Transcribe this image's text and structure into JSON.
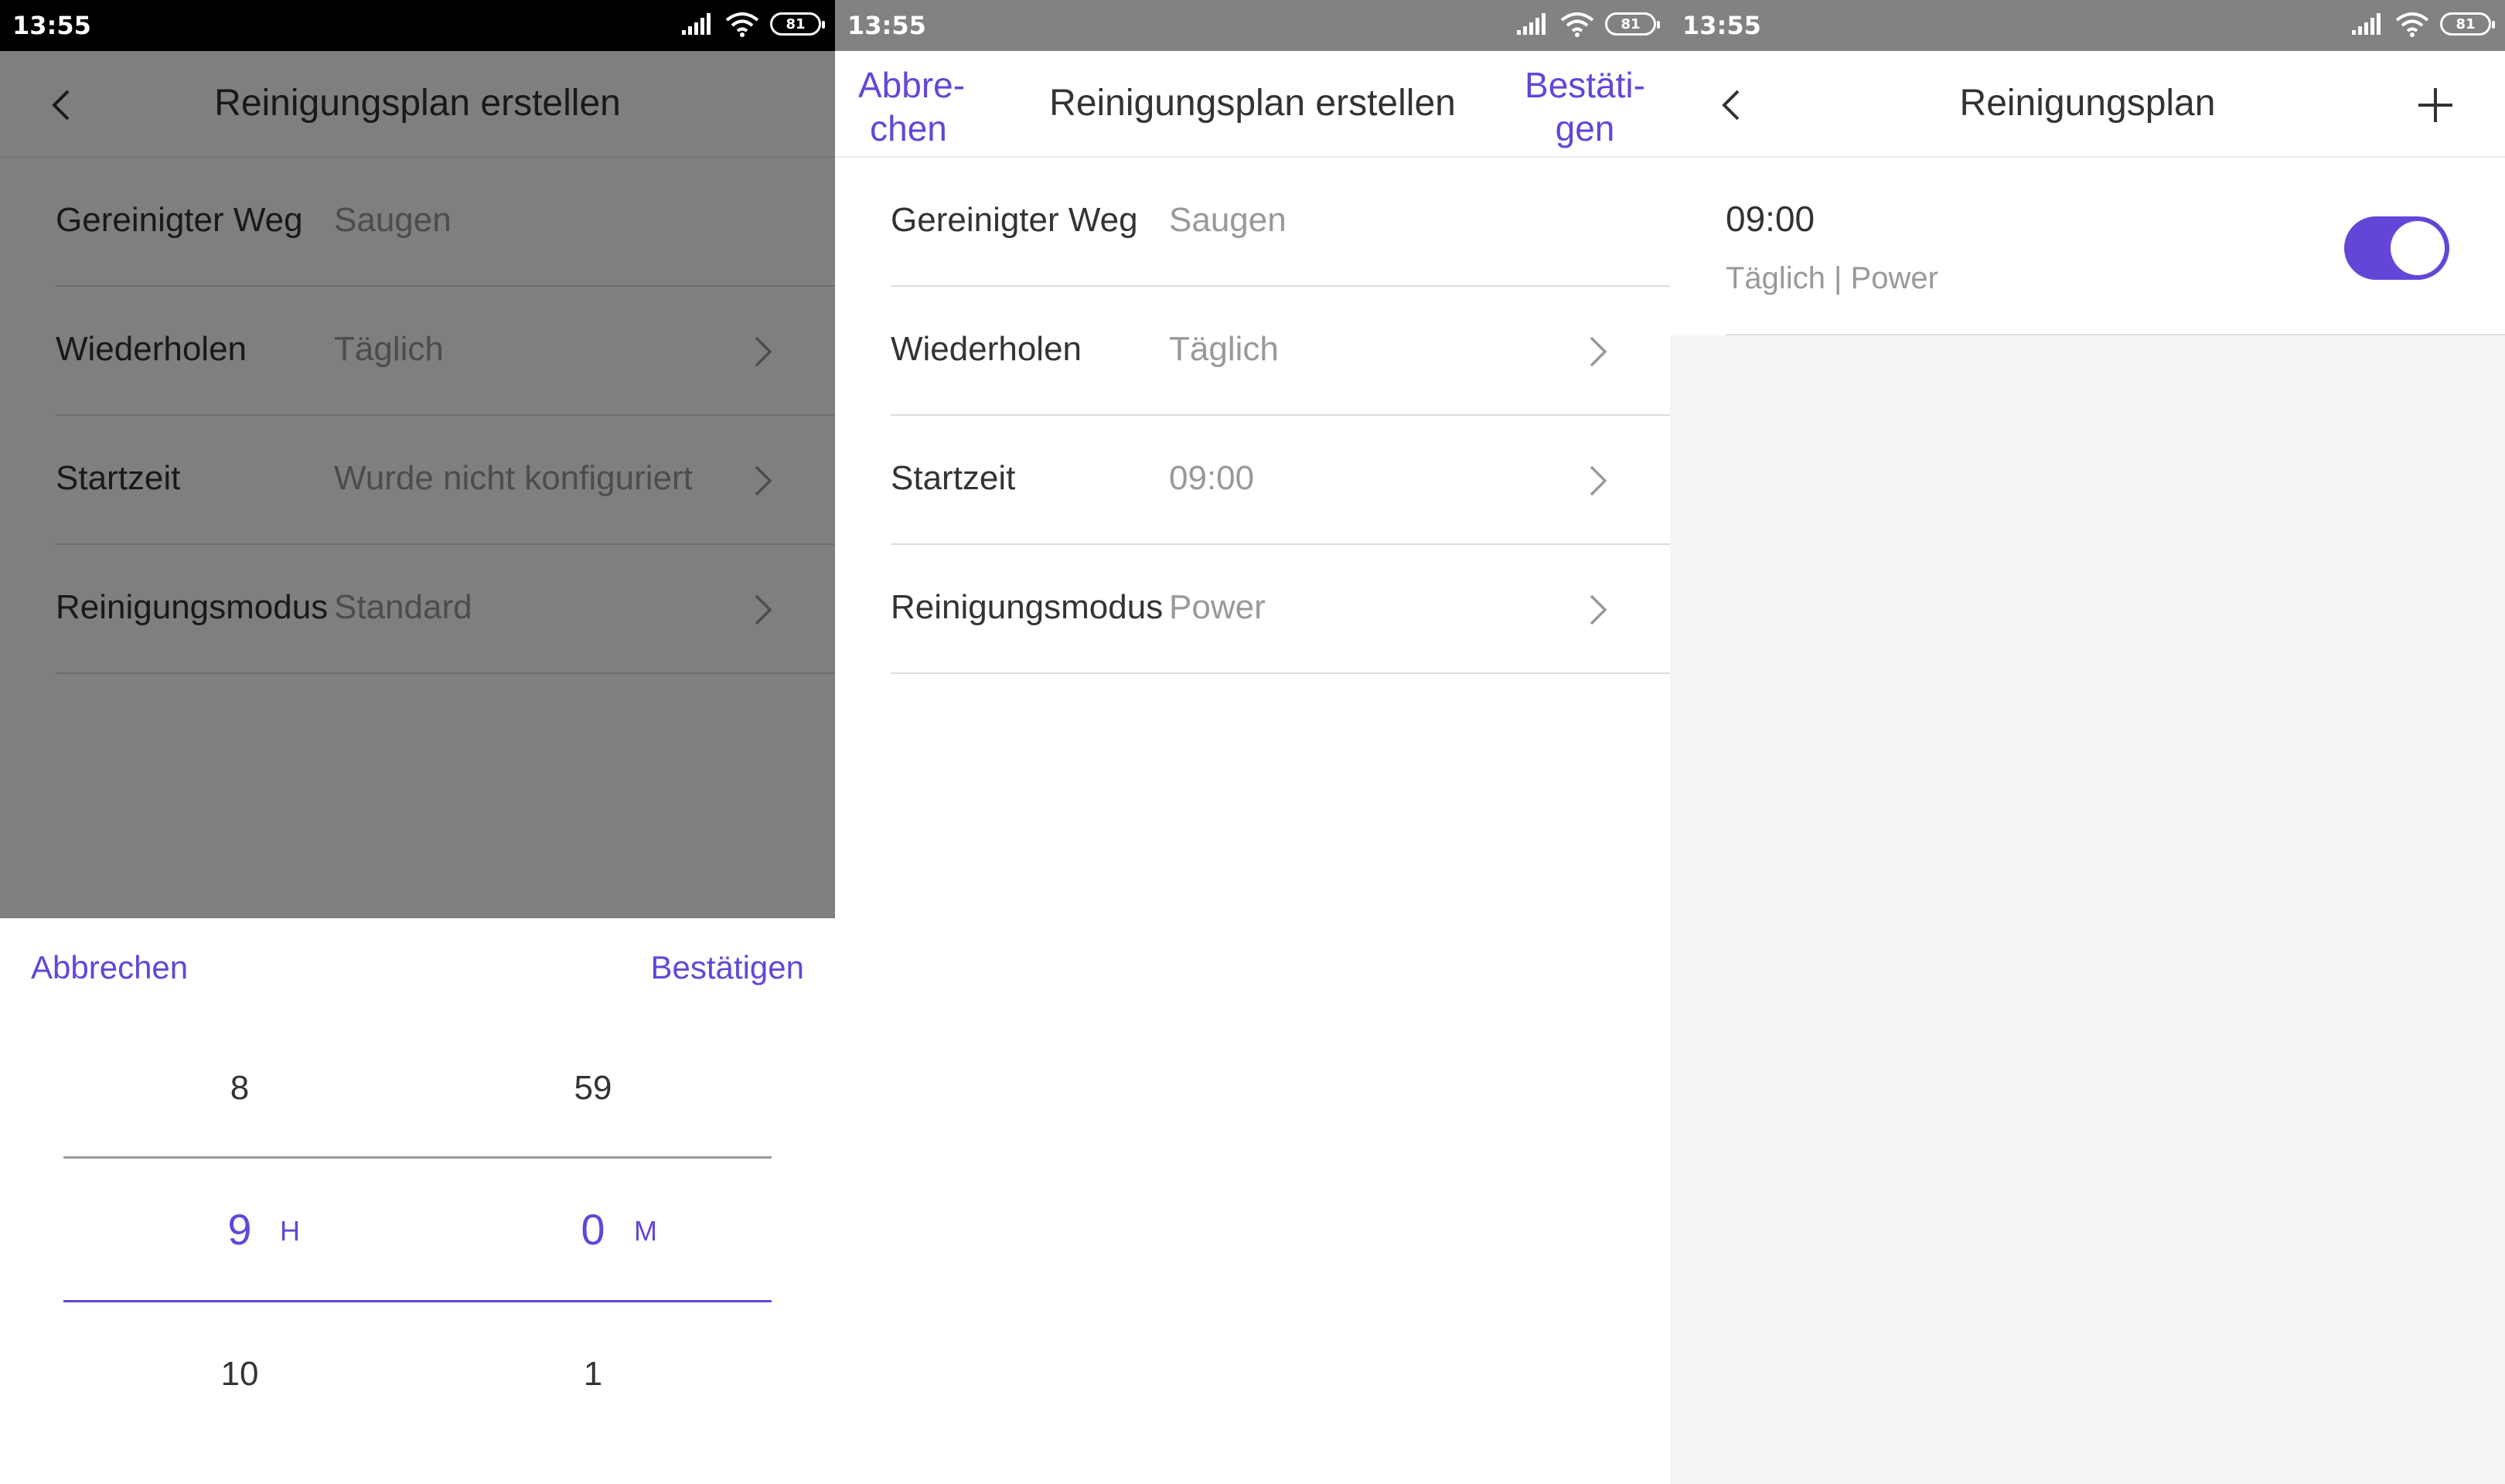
{
  "status": {
    "time": "13:55",
    "battery": "81"
  },
  "screen1": {
    "title": "Reinigungsplan erstellen",
    "rows": [
      {
        "label": "Gereinigter Weg",
        "value": "Saugen"
      },
      {
        "label": "Wiederholen",
        "value": "Täglich"
      },
      {
        "label": "Startzeit",
        "value": "Wurde nicht konfiguriert"
      },
      {
        "label": "Reinigungsmodus",
        "value": "Standard"
      }
    ],
    "picker": {
      "cancel": "Abbrechen",
      "confirm": "Bestätigen",
      "hours": {
        "prev": "8",
        "selected": "9",
        "next": "10",
        "unit": "H"
      },
      "minutes": {
        "prev": "59",
        "selected": "0",
        "next": "1",
        "unit": "M"
      }
    }
  },
  "screen2": {
    "cancel_line1": "Abbre-",
    "cancel_line2": "chen",
    "title": "Reinigungsplan erstellen",
    "confirm_line1": "Bestäti-",
    "confirm_line2": "gen",
    "rows": [
      {
        "label": "Gereinigter Weg",
        "value": "Saugen"
      },
      {
        "label": "Wiederholen",
        "value": "Täglich"
      },
      {
        "label": "Startzeit",
        "value": "09:00"
      },
      {
        "label": "Reinigungsmodus",
        "value": "Power"
      }
    ]
  },
  "screen3": {
    "title": "Reinigungsplan",
    "schedule": {
      "time": "09:00",
      "details": "Täglich | Power",
      "enabled": true
    }
  },
  "colors": {
    "accent": "#6346d8",
    "statusbar_dark": "#000000",
    "statusbar_gray": "#828282"
  }
}
